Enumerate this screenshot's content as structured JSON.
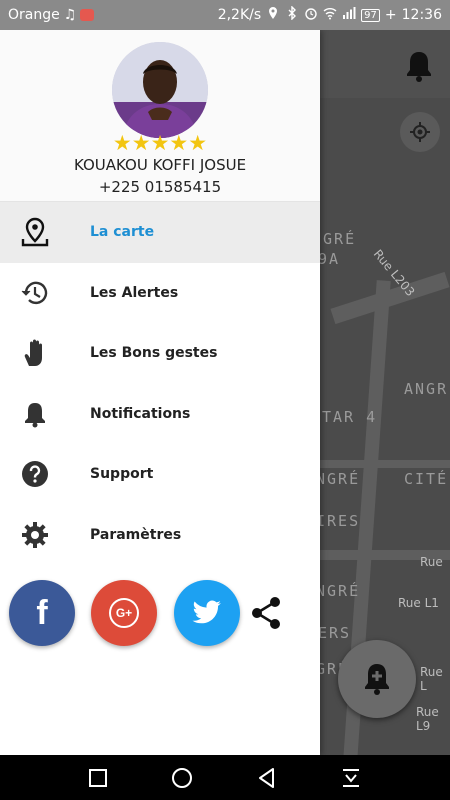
{
  "status_bar": {
    "carrier": "Orange",
    "speed": "2,2K/s",
    "battery": "97",
    "time": "12:36"
  },
  "user": {
    "name": "KOUAKOU KOFFI JOSUE",
    "phone": "+225 01585415",
    "rating_stars": "★★★★★",
    "rating": 5
  },
  "menu": {
    "items": [
      {
        "label": "La carte",
        "icon": "map-pin-icon",
        "active": true
      },
      {
        "label": "Les Alertes",
        "icon": "history-icon",
        "active": false
      },
      {
        "label": "Les Bons gestes",
        "icon": "hand-icon",
        "active": false
      },
      {
        "label": "Notifications",
        "icon": "bell-icon",
        "active": false
      },
      {
        "label": "Support",
        "icon": "help-icon",
        "active": false
      },
      {
        "label": "Paramètres",
        "icon": "gear-icon",
        "active": false
      }
    ]
  },
  "social": {
    "facebook_glyph": "f",
    "google_glyph": "G+",
    "colors": {
      "facebook": "#3b5998",
      "google": "#dd4b39",
      "twitter": "#1da1f2"
    }
  },
  "map": {
    "labels": [
      "NGRÉ",
      "9A",
      "ANGR",
      "TAR 4",
      "NGRÉ",
      "CITÉ",
      "IRES",
      "NGRÉ",
      "ERS",
      "GRÉ"
    ],
    "streets": [
      "Rue L203",
      "Rue",
      "Rue L1",
      "Rue L",
      "Rue L9"
    ]
  },
  "colors": {
    "accent": "#1e8fd3",
    "stars": "#f2c511"
  }
}
